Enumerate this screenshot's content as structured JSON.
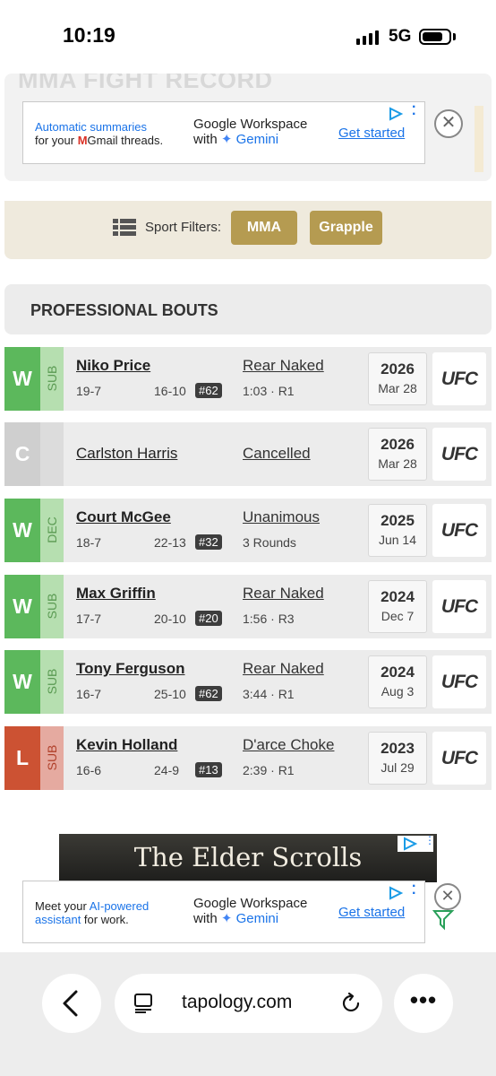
{
  "status_bar": {
    "time": "10:19",
    "network": "5G"
  },
  "page": {
    "heading": "MMA FIGHT RECORD"
  },
  "ads": {
    "top": {
      "left_line1": "Automatic summaries",
      "left_line2_pre": "for your ",
      "left_line2_brand": "Gmail threads.",
      "mid_line1": "Google Workspace",
      "mid_line2_pre": "with ",
      "mid_line2_brand": "Gemini",
      "cta": "Get started",
      "close": "✕"
    },
    "bottom": {
      "left_line1_pre": "Meet your ",
      "left_line1_brand": "AI-powered",
      "left_line2_brand": "assistant",
      "left_line2_post": " for work.",
      "mid_line1": "Google Workspace",
      "mid_line2_pre": "with ",
      "mid_line2_brand": "Gemini",
      "cta": "Get started",
      "close": "✕"
    },
    "banner": {
      "title": "The Elder Scrolls"
    }
  },
  "filters": {
    "label": "Sport Filters:",
    "chips": [
      "MMA",
      "Grapple"
    ]
  },
  "bouts": {
    "title": "PROFESSIONAL BOUTS",
    "rows": [
      {
        "result": "W",
        "method": "SUB",
        "opponent": "Niko Price",
        "record": "19-7",
        "opp_record": "16-10",
        "rank": "#62",
        "finish": "Rear Naked",
        "detail": "1:03 · R1",
        "year": "2026",
        "date": "Mar 28",
        "promotion": "UFC"
      },
      {
        "result": "C",
        "method": "",
        "opponent": "Carlston Harris",
        "record": "",
        "opp_record": "",
        "rank": "",
        "finish": "Cancelled",
        "detail": "",
        "year": "2026",
        "date": "Mar 28",
        "promotion": "UFC"
      },
      {
        "result": "W",
        "method": "DEC",
        "opponent": "Court McGee",
        "record": "18-7",
        "opp_record": "22-13",
        "rank": "#32",
        "finish": "Unanimous",
        "detail": "3 Rounds",
        "year": "2025",
        "date": "Jun 14",
        "promotion": "UFC"
      },
      {
        "result": "W",
        "method": "SUB",
        "opponent": "Max Griffin",
        "record": "17-7",
        "opp_record": "20-10",
        "rank": "#20",
        "finish": "Rear Naked",
        "detail": "1:56 · R3",
        "year": "2024",
        "date": "Dec 7",
        "promotion": "UFC"
      },
      {
        "result": "W",
        "method": "SUB",
        "opponent": "Tony Ferguson",
        "record": "16-7",
        "opp_record": "25-10",
        "rank": "#62",
        "finish": "Rear Naked",
        "detail": "3:44 · R1",
        "year": "2024",
        "date": "Aug 3",
        "promotion": "UFC"
      },
      {
        "result": "L",
        "method": "SUB",
        "opponent": "Kevin Holland",
        "record": "16-6",
        "opp_record": "24-9",
        "rank": "#13",
        "finish": "D'arce Choke",
        "detail": "2:39 · R1",
        "year": "2023",
        "date": "Jul 29",
        "promotion": "UFC"
      }
    ]
  },
  "browser": {
    "url": "tapology.com",
    "more": "•••"
  },
  "colors": {
    "win": "#5cb85c",
    "win_method": "#b6dfb0",
    "loss": "#cc5233",
    "loss_method": "#e5aaa0",
    "cancel": "#cfcfcf",
    "cancel_method": "#dcdcdc",
    "gold": "#b59b51",
    "link": "#1a73e8"
  }
}
